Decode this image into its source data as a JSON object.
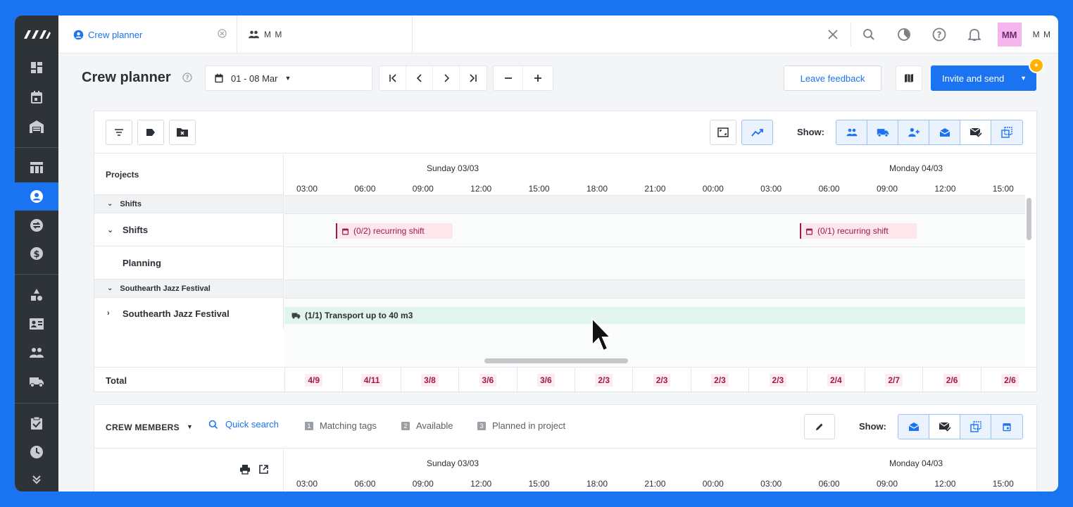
{
  "tabs": [
    {
      "label": "Crew planner"
    },
    {
      "label": "M M"
    }
  ],
  "user": {
    "avatar": "MM",
    "initials": "M M"
  },
  "title": {
    "page": "Crew planner",
    "date_range": "01 - 08 Mar",
    "feedback": "Leave feedback",
    "invite": "Invite and send"
  },
  "toolbar": {
    "show_label": "Show:"
  },
  "timeline": {
    "days": [
      "Sunday 03/03",
      "Monday 04/03"
    ],
    "hours": [
      "03:00",
      "06:00",
      "09:00",
      "12:00",
      "15:00",
      "18:00",
      "21:00",
      "00:00",
      "03:00",
      "06:00",
      "09:00",
      "12:00",
      "15:00"
    ]
  },
  "projects": {
    "header": "Projects",
    "groups": [
      {
        "label": "Shifts",
        "rows": [
          {
            "label": "Shifts"
          },
          {
            "label": "Planning"
          }
        ]
      },
      {
        "label": "Southearth Jazz Festival",
        "rows": [
          {
            "label": "Southearth Jazz Festival"
          }
        ]
      }
    ],
    "bars": {
      "shift1": "(0/2) recurring shift",
      "shift2": "(0/1) recurring shift",
      "transport": "(1/1) Transport up to 40 m3"
    },
    "total_label": "Total",
    "totals": [
      "4/9",
      "4/11",
      "3/8",
      "3/6",
      "3/6",
      "2/3",
      "2/3",
      "2/3",
      "2/3",
      "2/4",
      "2/7",
      "2/6",
      "2/6"
    ]
  },
  "crew": {
    "title": "CREW MEMBERS",
    "quick_search": "Quick search",
    "filters": [
      {
        "num": "1",
        "label": "Matching tags"
      },
      {
        "num": "2",
        "label": "Available"
      },
      {
        "num": "3",
        "label": "Planned in project"
      }
    ],
    "show_label": "Show:"
  },
  "colors": {
    "accent": "#1a73f0",
    "sidebar": "#2e3338",
    "shift": "#9e1b47",
    "transport": "#e2f5ec"
  }
}
